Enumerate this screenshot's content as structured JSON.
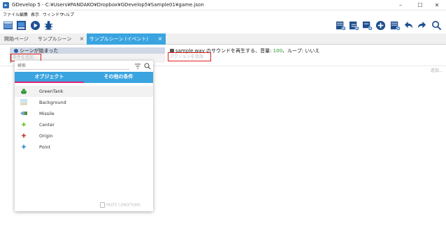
{
  "window": {
    "title": "GDevelop 5 - C:¥Users¥PANDAKO¥Dropbox¥GDevelop5¥Sample01¥game.json",
    "minimize": "–",
    "maximize": "☐",
    "close": "✕"
  },
  "menu": {
    "items": [
      {
        "label": "ファイル"
      },
      {
        "label": "編集"
      },
      {
        "label": "表示"
      },
      {
        "label": "ウィンドウ"
      },
      {
        "label": "ヘルプ"
      }
    ]
  },
  "tabs": [
    {
      "label": "開始ページ"
    },
    {
      "label": "サンプルシーン"
    },
    {
      "label": "サンプルシーン (イベント)"
    }
  ],
  "tab_close": "×",
  "event": {
    "condition_text": "シーンが始まった",
    "add_condition": "条件を追加",
    "action_prefix": "sample.wav のサウンドを再生する、音量: ",
    "action_volume": "100",
    "action_suffix": "、ループ: いいえ",
    "add_action": "アクションを追加",
    "add_event": "追加..."
  },
  "popup": {
    "search_placeholder": "検索",
    "tab_objects": "オブジェクト",
    "tab_other": "その他の条件",
    "objects": [
      {
        "label": "GreenTank",
        "icon": "tank-icon",
        "color": "#3fa33f"
      },
      {
        "label": "Background",
        "icon": "image-icon",
        "color": "#a8d8f0"
      },
      {
        "label": "Missile",
        "icon": "missile-icon",
        "color": "#7aa7c8"
      },
      {
        "label": "Center",
        "icon": "point-icon",
        "color": "#6bbf2a"
      },
      {
        "label": "Origin",
        "icon": "point-icon",
        "color": "#c0392b"
      },
      {
        "label": "Point",
        "icon": "point-icon",
        "color": "#2e8bcb"
      }
    ],
    "paste_label": "PASTE CONDITIONS"
  },
  "colors": {
    "accent": "#3aa4e0",
    "tab_indicator": "#e4237a",
    "highlight_box": "#e02020"
  }
}
